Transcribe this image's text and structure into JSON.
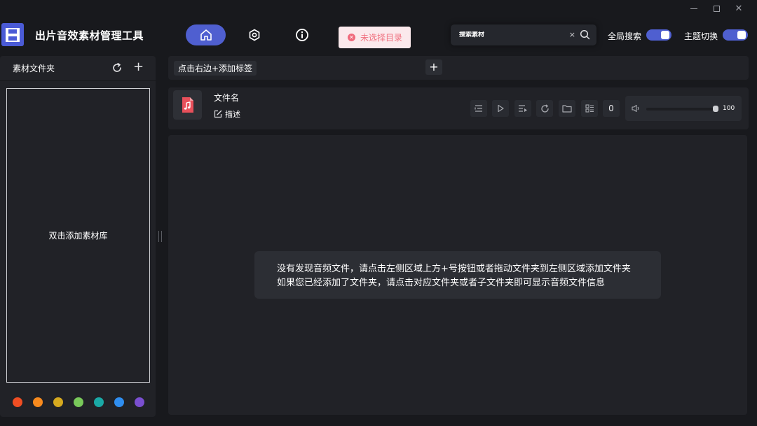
{
  "app": {
    "title": "出片音效素材管理工具"
  },
  "toast": {
    "text": "未选择目录"
  },
  "search": {
    "placeholder": "搜索素材",
    "clear": "×"
  },
  "toggles": {
    "global_search": "全局搜索",
    "theme_switch": "主题切换"
  },
  "sidebar": {
    "title": "素材文件夹",
    "add": "+",
    "dropzone_text": "双击添加素材库",
    "color_dots": [
      "#f04e23",
      "#f78a1e",
      "#d6a91f",
      "#79c95a",
      "#1aa9a6",
      "#2f8ef0",
      "#7a4fd0"
    ]
  },
  "tagbar": {
    "hint": "点击右边+添加标签",
    "add": "+"
  },
  "player": {
    "file_name": "文件名",
    "description": "描述",
    "count": "0",
    "volume": 100,
    "volume_label": "100"
  },
  "content": {
    "empty_lines": [
      "没有发现音频文件，请点击左侧区域上方+号按钮或者拖动文件夹到左侧区域添加文件夹",
      "如果您已经添加了文件夹，请点击对应文件夹或者子文件夹即可显示音频文件信息"
    ]
  },
  "colors": {
    "accent": "#4f5fd0",
    "background": "#18191d",
    "panel": "#212227",
    "file_icon": "#e8505b"
  },
  "icons": [
    "home-icon",
    "settings-icon",
    "info-icon",
    "search-icon",
    "refresh-icon",
    "music-file-icon",
    "edit-icon",
    "list-icon",
    "play-icon",
    "playlist-icon",
    "loop-icon",
    "folder-icon",
    "grid-icon",
    "volume-icon"
  ]
}
